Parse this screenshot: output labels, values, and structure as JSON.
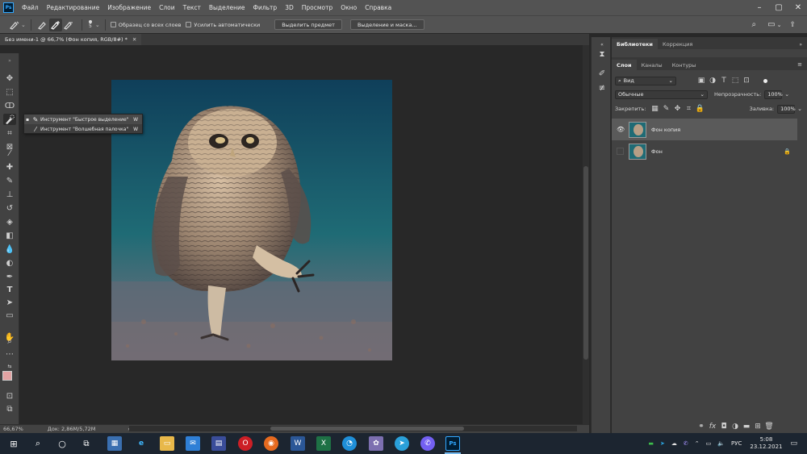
{
  "app": {
    "logo": "Ps",
    "menu": [
      "Файл",
      "Редактирование",
      "Изображение",
      "Слои",
      "Текст",
      "Выделение",
      "Фильтр",
      "3D",
      "Просмотр",
      "Окно",
      "Справка"
    ]
  },
  "options_bar": {
    "brush_size": "5",
    "sample_all_layers": "Образец со всех слоев",
    "auto_enhance": "Усилить автоматически",
    "select_subject": "Выделить предмет",
    "select_and_mask": "Выделение и маска..."
  },
  "document": {
    "tab_title": "Без имени-1 @ 66,7% (Фон копия, RGB/8#) *"
  },
  "flyout": {
    "items": [
      {
        "label": "Инструмент \"Быстрое выделение\"",
        "key": "W",
        "active": true
      },
      {
        "label": "Инструмент \"Волшебная палочка\"",
        "key": "W",
        "active": false
      }
    ]
  },
  "status": {
    "zoom": "66,67%",
    "doc_info": "Док: 2,86M/5,72M"
  },
  "panels": {
    "top_tabs": [
      "Библиотеки",
      "Коррекция"
    ],
    "layer_tabs": [
      "Слои",
      "Каналы",
      "Контуры"
    ],
    "filter_kind": "Вид",
    "blend_mode": "Обычные",
    "opacity_label": "Непрозрачность:",
    "opacity_value": "100%",
    "lock_label": "Закрепить:",
    "fill_label": "Заливка:",
    "fill_value": "100%",
    "layers": [
      {
        "name": "Фон копия",
        "visible": true,
        "selected": true,
        "locked": false
      },
      {
        "name": "Фон",
        "visible": false,
        "selected": false,
        "locked": true
      }
    ]
  },
  "taskbar": {
    "language": "РУС",
    "time": "5:08",
    "date": "23.12.2021"
  },
  "colors": {
    "foreground_swatch": "#e2a3a3",
    "background_swatch": "#a6e0a0",
    "accent": "#31a8ff"
  }
}
